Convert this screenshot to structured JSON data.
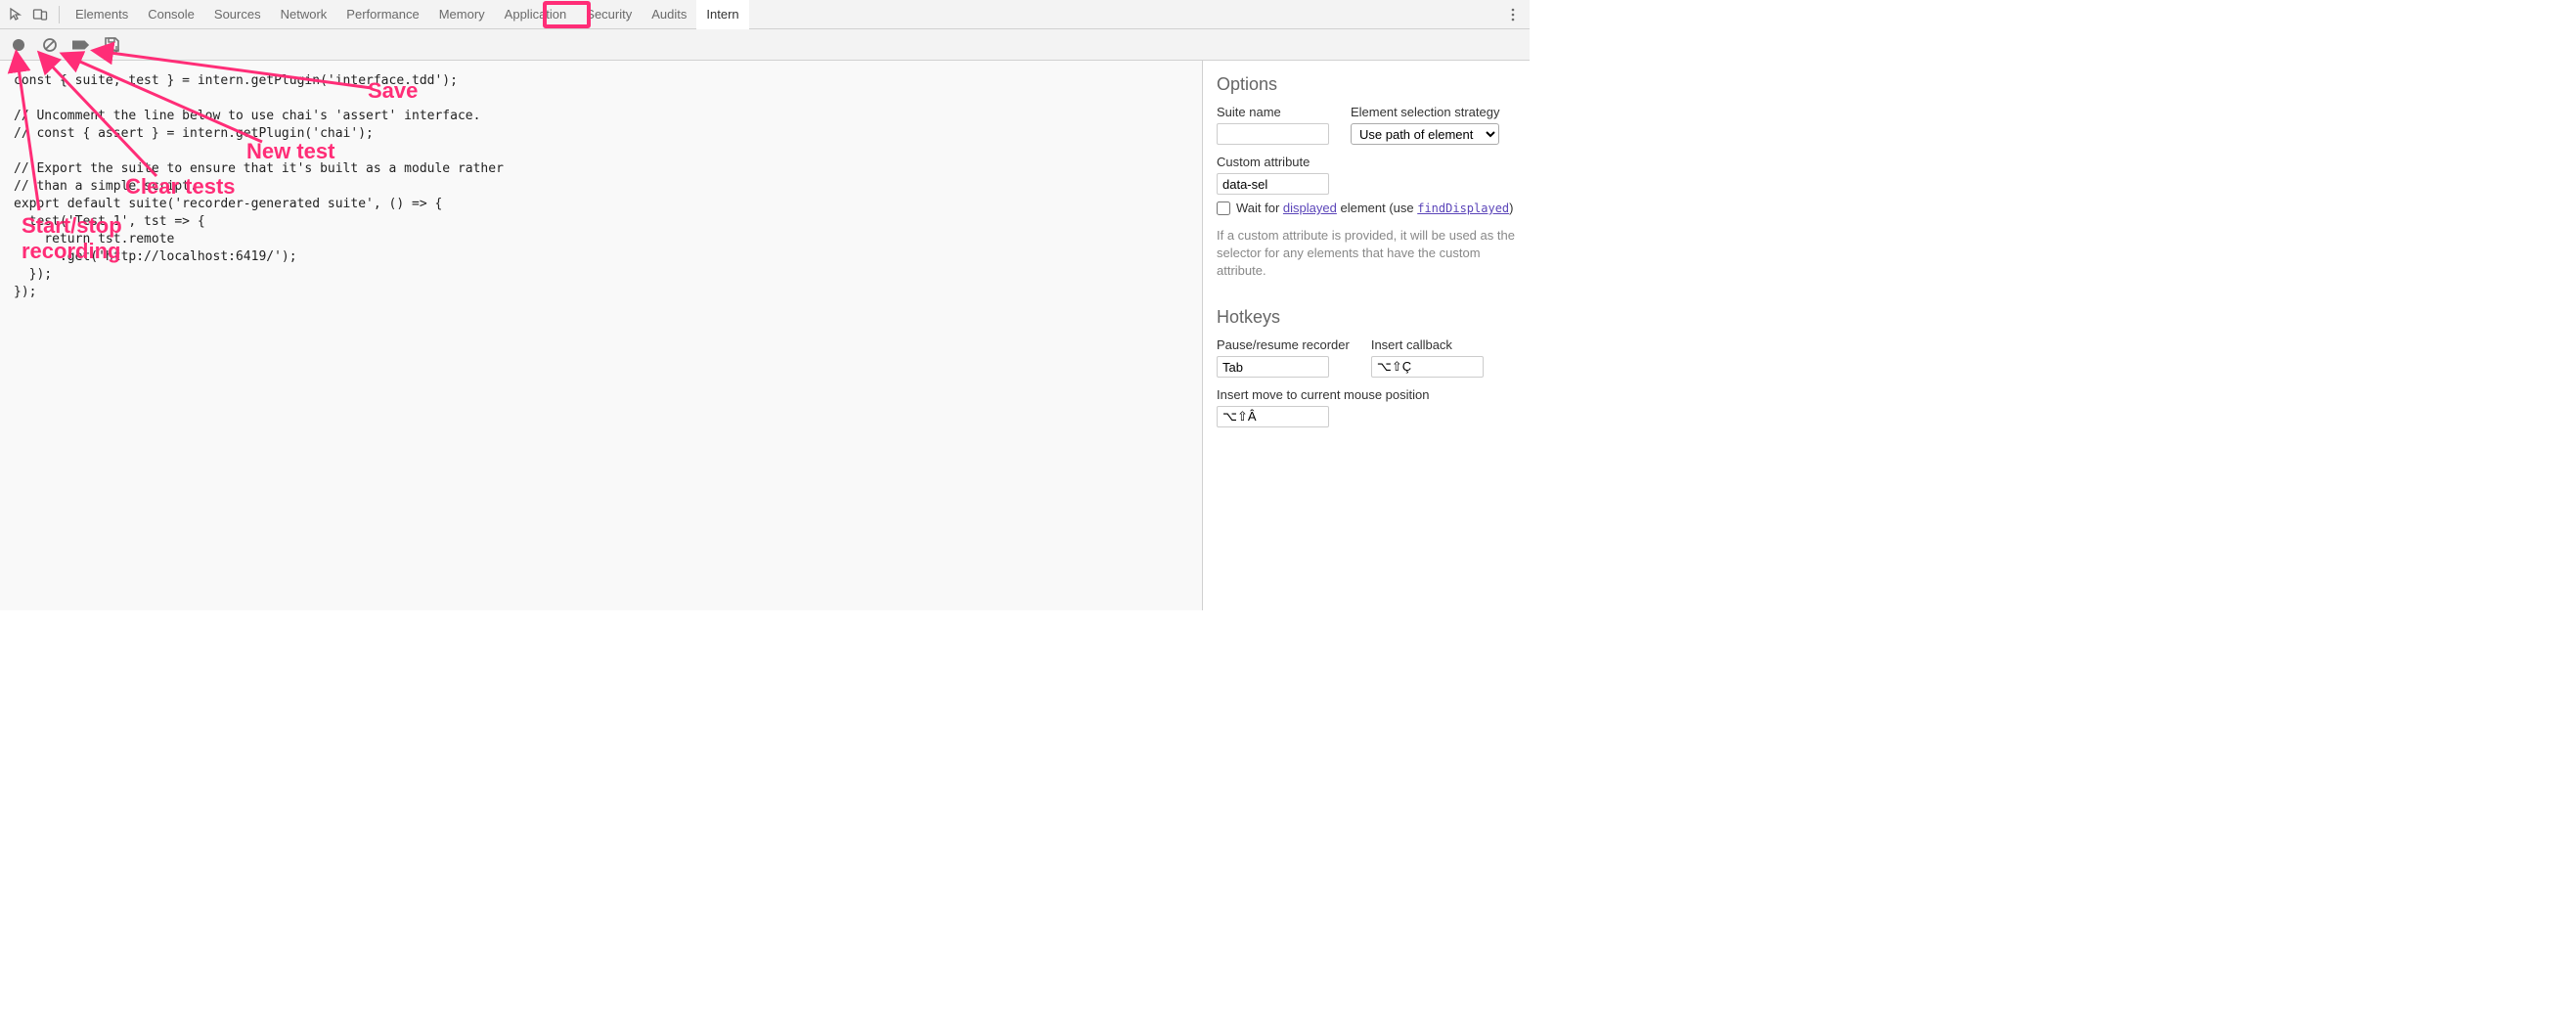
{
  "tabs": [
    "Elements",
    "Console",
    "Sources",
    "Network",
    "Performance",
    "Memory",
    "Application",
    "Security",
    "Audits",
    "Intern"
  ],
  "active_tab": "Intern",
  "toolbar_icons": [
    "record-icon",
    "clear-icon",
    "newtest-icon",
    "save-icon"
  ],
  "code": "const { suite, test } = intern.getPlugin('interface.tdd');\n\n// Uncomment the line below to use chai's 'assert' interface.\n// const { assert } = intern.getPlugin('chai');\n\n// Export the suite to ensure that it's built as a module rather\n// than a simple script.\nexport default suite('recorder-generated suite', () => {\n  test('Test 1', tst => {\n    return tst.remote\n      .get('http://localhost:6419/');\n  });\n});",
  "options": {
    "heading": "Options",
    "suite_name_label": "Suite name",
    "suite_name_value": "",
    "strategy_label": "Element selection strategy",
    "strategy_value": "Use path of element",
    "custom_attr_label": "Custom attribute",
    "custom_attr_value": "data-sel",
    "wait_prefix": "Wait for ",
    "wait_link": "displayed",
    "wait_mid": " element (use ",
    "wait_code": "findDisplayed",
    "wait_suffix": ")",
    "help_text": "If a custom attribute is provided, it will be used as the selector for any elements that have the custom attribute."
  },
  "hotkeys": {
    "heading": "Hotkeys",
    "pause_label": "Pause/resume recorder",
    "pause_value": "Tab",
    "callback_label": "Insert callback",
    "callback_value": "⌥⇧Ç",
    "move_label": "Insert move to current mouse position",
    "move_value": "⌥⇧Â"
  },
  "annotations": {
    "record": "Start/stop\nrecording",
    "clear": "Clear tests",
    "newtest": "New test",
    "save": "Save"
  }
}
